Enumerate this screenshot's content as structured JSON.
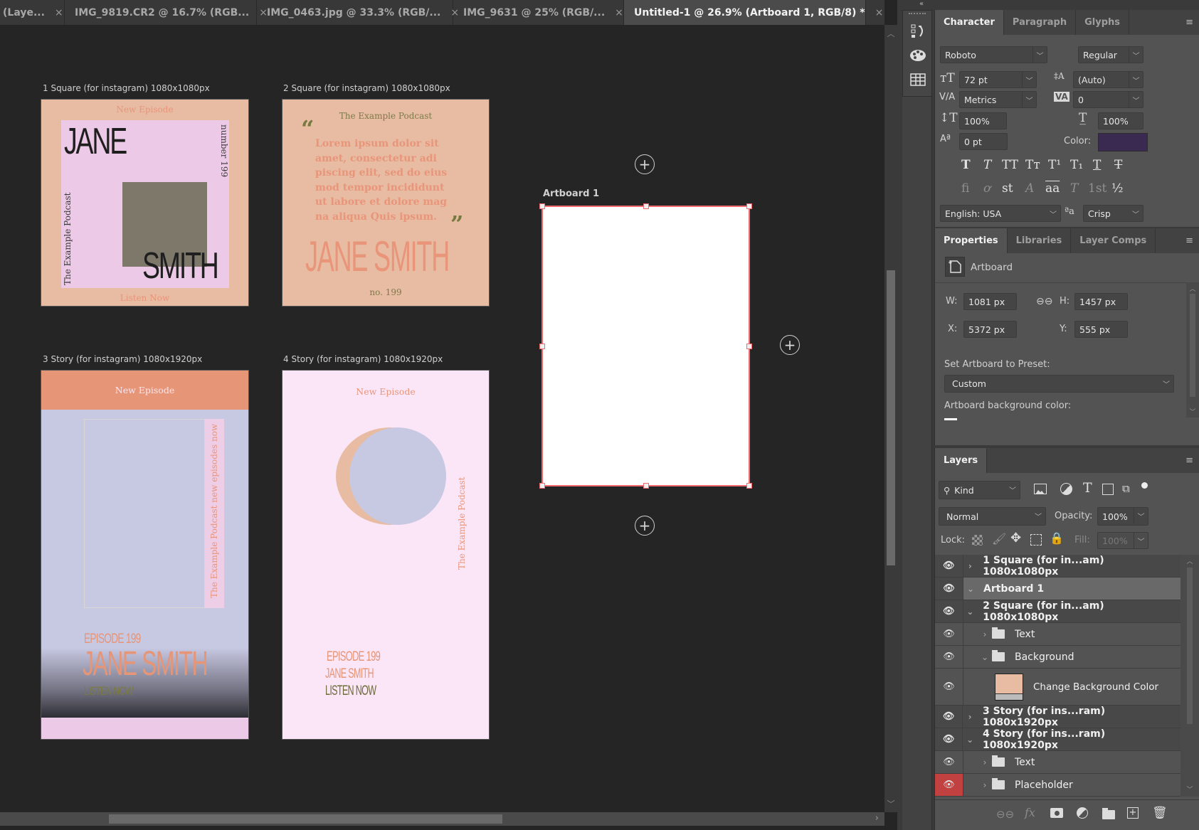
{
  "tabs": [
    {
      "label": "(Laye...",
      "active": false
    },
    {
      "label": "IMG_9819.CR2 @ 16.7% (RGB...",
      "active": false
    },
    {
      "label": "IMG_0463.jpg @ 33.3% (RGB/...",
      "active": false
    },
    {
      "label": "IMG_9631 @ 25% (RGB/...",
      "active": false
    },
    {
      "label": "Untitled-1 @ 26.9% (Artboard 1, RGB/8) *",
      "active": true
    }
  ],
  "tab_close_glyph": "×",
  "canvas": {
    "artboards": [
      {
        "label": "1 Square (for instagram) 1080x1080px",
        "new_episode": "New Episode",
        "first": "JANE",
        "last": "SMITH",
        "number": "number 199",
        "podcast": "The Example Podcast",
        "cta": "Listen Now"
      },
      {
        "label": "2 Square (for instagram) 1080x1080px",
        "podcast": "The Example Podcast",
        "open_quote": "“",
        "close_quote": "”",
        "quote_lines": [
          "Lorem ipsum dolor sit",
          "amet, consectetur adi",
          "piscing elit, sed do eius",
          "mod tempor incididunt",
          "ut labore et dolore mag",
          "na aliqua Quis ipsum."
        ],
        "name": "JANE SMITH",
        "number": "no. 199"
      },
      {
        "label": "3 Story (for instagram) 1080x1920px",
        "new_episode": "New Episode",
        "vertical": "The Example Podcast new episodes now",
        "episode": "EPISODE 199",
        "name": "JANE SMITH",
        "cta": "LISTEN NOW"
      },
      {
        "label": "4 Story (for instagram) 1080x1920px",
        "new_episode": "New Episode",
        "vertical": "The Example Podcast",
        "episode": "EPISODE 199",
        "name": "JANE SMITH",
        "cta": "LISTEN NOW"
      }
    ],
    "active_artboard": {
      "label": "Artboard 1"
    },
    "add_artboard_glyph": "+"
  },
  "colors": {
    "selection": "#f06a70",
    "peach": "#e8bba3",
    "salmon": "#e69577",
    "lavender": "#c7c8e2",
    "pink": "#ecc9e6",
    "olive": "#7a7a40",
    "text_color_swatch": "#3a2a52",
    "bg_swatch": "#e8bba3"
  },
  "character": {
    "tabs": [
      "Character",
      "Paragraph",
      "Glyphs"
    ],
    "font_family": "Roboto",
    "font_style": "Regular",
    "font_size": "72 pt",
    "leading": "(Auto)",
    "kerning": "Metrics",
    "tracking": "0",
    "vertical_scale": "100%",
    "horizontal_scale": "100%",
    "baseline_shift": "0 pt",
    "color_label": "Color:",
    "style_buttons": [
      "T",
      "T",
      "TT",
      "Tт",
      "T¹",
      "T₁",
      "T",
      "T"
    ],
    "opentype_buttons": [
      "ﬁ",
      "ơ",
      "st",
      "A",
      "aa",
      "T",
      "1st",
      "½"
    ],
    "language": "English: USA",
    "aa_icon": "ªa",
    "antialias": "Crisp"
  },
  "properties": {
    "tabs": [
      "Properties",
      "Libraries",
      "Layer Comps"
    ],
    "type_label": "Artboard",
    "w_label": "W:",
    "w": "1081 px",
    "h_label": "H:",
    "h": "1457 px",
    "x_label": "X:",
    "x": "5372 px",
    "y_label": "Y:",
    "y": "555 px",
    "preset_label": "Set Artboard to Preset:",
    "preset": "Custom",
    "bg_label": "Artboard background color:"
  },
  "layers": {
    "tab": "Layers",
    "filter": "Kind",
    "blend_mode": "Normal",
    "opacity_label": "Opacity:",
    "opacity": "100%",
    "lock_label": "Lock:",
    "fill_label": "Fill:",
    "fill": "100%",
    "rows": [
      {
        "name": "1 Square (for in...am) 1080x1080px",
        "type": "artboard",
        "expanded": false,
        "depth": 0
      },
      {
        "name": "Artboard 1",
        "type": "artboard",
        "expanded": true,
        "depth": 0,
        "selected": true
      },
      {
        "name": "2 Square (for in...am) 1080x1080px",
        "type": "artboard",
        "expanded": true,
        "depth": 0
      },
      {
        "name": "Text",
        "type": "group",
        "expanded": false,
        "depth": 1
      },
      {
        "name": "Background",
        "type": "group",
        "expanded": true,
        "depth": 1
      },
      {
        "name": "Change Background Color",
        "type": "fill",
        "depth": 2
      },
      {
        "name": "3 Story (for ins...ram) 1080x1920px",
        "type": "artboard",
        "expanded": false,
        "depth": 0
      },
      {
        "name": "4 Story (for ins...ram) 1080x1920px",
        "type": "artboard",
        "expanded": true,
        "depth": 0
      },
      {
        "name": "Text",
        "type": "group",
        "expanded": false,
        "depth": 1
      },
      {
        "name": "Placeholder",
        "type": "group",
        "expanded": false,
        "depth": 1,
        "eye_highlight": true
      }
    ]
  }
}
